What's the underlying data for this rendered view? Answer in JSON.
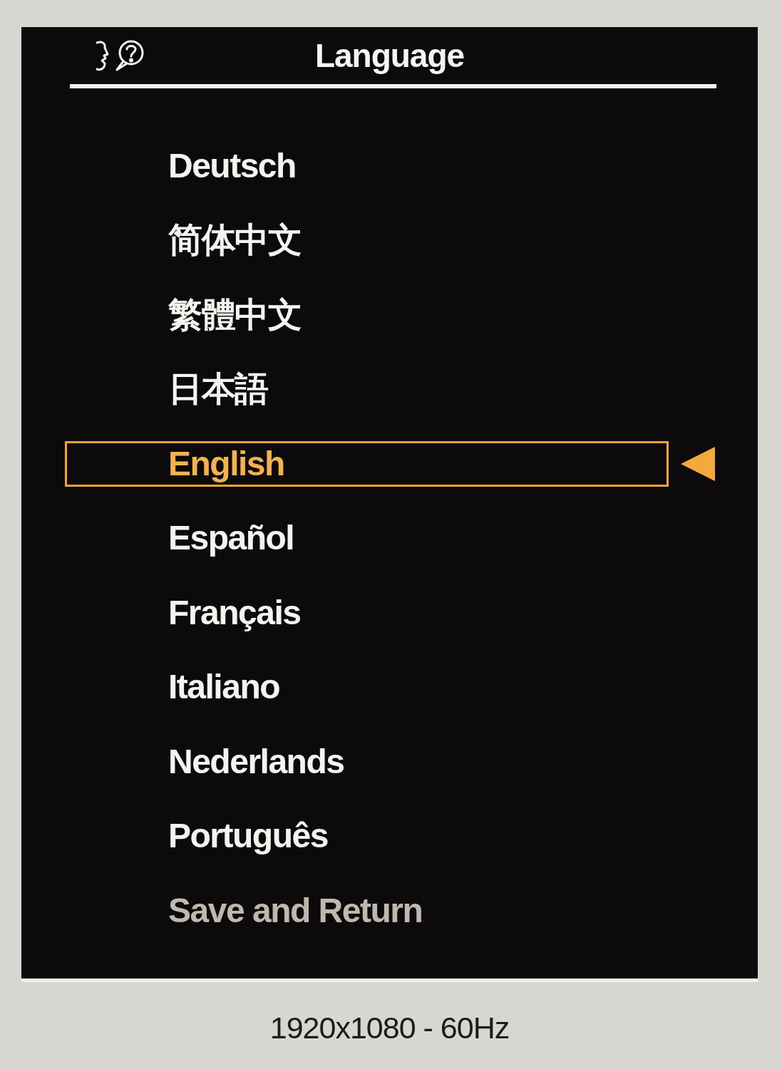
{
  "osd": {
    "title": "Language",
    "items": [
      {
        "label": "Deutsch",
        "kind": "language",
        "selected": false
      },
      {
        "label": "简体中文",
        "kind": "language",
        "selected": false
      },
      {
        "label": "繁體中文",
        "kind": "language",
        "selected": false
      },
      {
        "label": "日本語",
        "kind": "language",
        "selected": false
      },
      {
        "label": "English",
        "kind": "language",
        "selected": true
      },
      {
        "label": "Español",
        "kind": "language",
        "selected": false
      },
      {
        "label": "Français",
        "kind": "language",
        "selected": false
      },
      {
        "label": "Italiano",
        "kind": "language",
        "selected": false
      },
      {
        "label": "Nederlands",
        "kind": "language",
        "selected": false
      },
      {
        "label": "Português",
        "kind": "language",
        "selected": false
      },
      {
        "label": "Save and Return",
        "kind": "action",
        "selected": false
      }
    ]
  },
  "status_bar": {
    "text": "1920x1080 - 60Hz"
  }
}
